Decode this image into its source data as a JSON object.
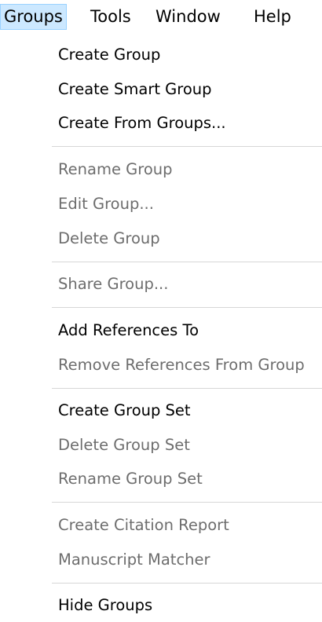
{
  "menubar": {
    "items": [
      {
        "label": "Groups"
      },
      {
        "label": "Tools"
      },
      {
        "label": "Window"
      },
      {
        "label": "Help"
      }
    ]
  },
  "groups_menu": {
    "items": [
      {
        "label": "Create Group",
        "enabled": true
      },
      {
        "label": "Create Smart Group",
        "enabled": true
      },
      {
        "label": "Create From Groups...",
        "enabled": true
      },
      {
        "label": "Rename Group",
        "enabled": false
      },
      {
        "label": "Edit Group...",
        "enabled": false
      },
      {
        "label": "Delete Group",
        "enabled": false
      },
      {
        "label": "Share Group...",
        "enabled": false
      },
      {
        "label": "Add References To",
        "enabled": true
      },
      {
        "label": "Remove References From Group",
        "enabled": false
      },
      {
        "label": "Create Group Set",
        "enabled": true
      },
      {
        "label": "Delete Group Set",
        "enabled": false
      },
      {
        "label": "Rename Group Set",
        "enabled": false
      },
      {
        "label": "Create Citation Report",
        "enabled": false
      },
      {
        "label": "Manuscript Matcher",
        "enabled": false
      },
      {
        "label": "Hide Groups",
        "enabled": true
      }
    ]
  },
  "colors": {
    "enabled_text": "#000000",
    "disabled_text": "#6d6d6d",
    "active_menu_bg": "#cce8ff",
    "separator": "#d7d7d7"
  }
}
